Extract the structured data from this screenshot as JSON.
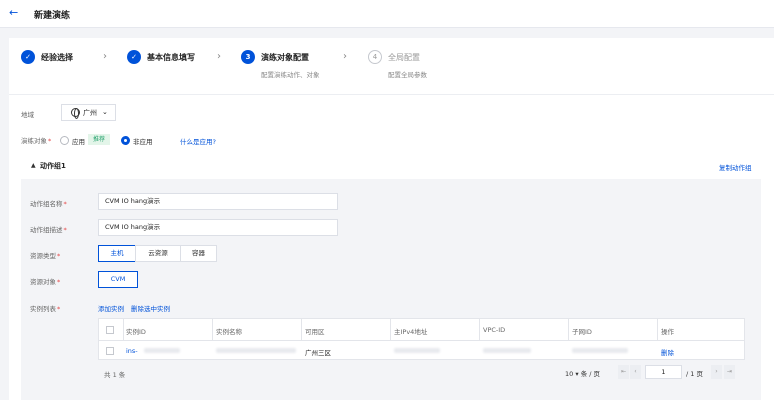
{
  "header": {
    "back_icon": "arrow-left-icon",
    "title": "新建演练"
  },
  "steps": [
    {
      "number": "",
      "label": "经验选择",
      "desc": "",
      "state": "done"
    },
    {
      "number": "",
      "label": "基本信息填写",
      "desc": "",
      "state": "done"
    },
    {
      "number": "3",
      "label": "演练对象配置",
      "desc": "配置演练动作、对象",
      "state": "active"
    },
    {
      "number": "4",
      "label": "全局配置",
      "desc": "配置全局参数",
      "state": "todo"
    }
  ],
  "region": {
    "label": "地域",
    "value": "广州"
  },
  "drill_object": {
    "label": "演练对象",
    "options": [
      {
        "label": "应用",
        "checked": false
      },
      {
        "label": "非应用",
        "checked": true
      }
    ],
    "recommend_tag": "推荐",
    "help_link": "什么是应用?"
  },
  "action_group": {
    "title": "动作组1",
    "copy_link": "复制动作组",
    "name_label": "动作组名称",
    "name_value": "CVM IO hang演示",
    "desc_label": "动作组描述",
    "desc_value": "CVM IO hang演示",
    "resource_type_label": "资源类型",
    "resource_types": [
      "主机",
      "云资源",
      "容器"
    ],
    "resource_object_label": "资源对象",
    "resource_object_value": "CVM",
    "instance_list_label": "实例列表",
    "add_instance": "添加实例",
    "delete_selected": "删除选中实例"
  },
  "table": {
    "columns": [
      "实例ID",
      "实例名称",
      "可用区",
      "主IPv4地址",
      "VPC-ID",
      "子网ID",
      "操作"
    ],
    "rows": [
      {
        "instance_id": "ins-",
        "zone": "广州三区",
        "action": "删除"
      }
    ]
  },
  "pagination": {
    "total": "共 1 条",
    "page_size": "10",
    "per_page_unit": "条 / 页",
    "current_page": "1",
    "total_pages": "/ 1 页"
  },
  "colors": {
    "primary": "#0052d9",
    "required": "#e54545",
    "success": "#2ba471"
  }
}
